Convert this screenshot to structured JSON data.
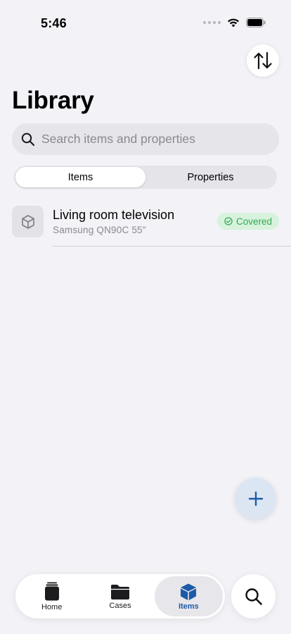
{
  "status_bar": {
    "time": "5:46"
  },
  "page": {
    "title": "Library"
  },
  "search": {
    "placeholder": "Search items and properties"
  },
  "segments": [
    {
      "label": "Items",
      "selected": true
    },
    {
      "label": "Properties",
      "selected": false
    }
  ],
  "items": [
    {
      "title": "Living room television",
      "subtitle": "Samsung QN90C 55\"",
      "status": "Covered"
    }
  ],
  "tabs": [
    {
      "label": "Home",
      "icon": "home-icon",
      "selected": false
    },
    {
      "label": "Cases",
      "icon": "folder-icon",
      "selected": false
    },
    {
      "label": "Items",
      "icon": "box-icon",
      "selected": true
    }
  ],
  "colors": {
    "background": "#f2f2f7",
    "accent": "#1e5aa8",
    "covered_badge_bg": "#d7f2dd",
    "covered_badge_text": "#34a853",
    "fab_bg": "#dce6f3"
  },
  "icons": {
    "sort": "sort-arrows-icon",
    "search": "search-icon",
    "add": "plus-icon",
    "item_thumb": "box-outline-icon",
    "badge": "checkmark-circle-icon"
  }
}
